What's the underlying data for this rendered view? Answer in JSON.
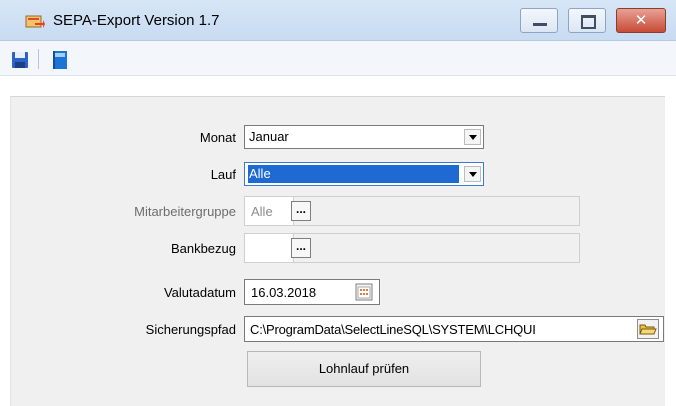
{
  "window": {
    "title": "SEPA-Export Version 1.7"
  },
  "toolbar": {
    "save_icon": "save-icon",
    "book_icon": "book-icon"
  },
  "form": {
    "monat": {
      "label": "Monat",
      "value": "Januar"
    },
    "lauf": {
      "label": "Lauf",
      "value": "Alle"
    },
    "mitarbeitergruppe": {
      "label": "Mitarbeitergruppe",
      "value": "Alle",
      "button": "..."
    },
    "bankbezug": {
      "label": "Bankbezug",
      "value": "",
      "button": "..."
    },
    "valutadatum": {
      "label": "Valutadatum",
      "value": "16.03.2018"
    },
    "sicherungspfad": {
      "label": "Sicherungspfad",
      "value": "C:\\ProgramData\\SelectLineSQL\\SYSTEM\\LCHQUI"
    },
    "check_button": "Lohnlauf prüfen"
  },
  "colors": {
    "selection": "#1f69d3",
    "titlebar": "#d7e6f7",
    "close_button": "#c84b36"
  }
}
